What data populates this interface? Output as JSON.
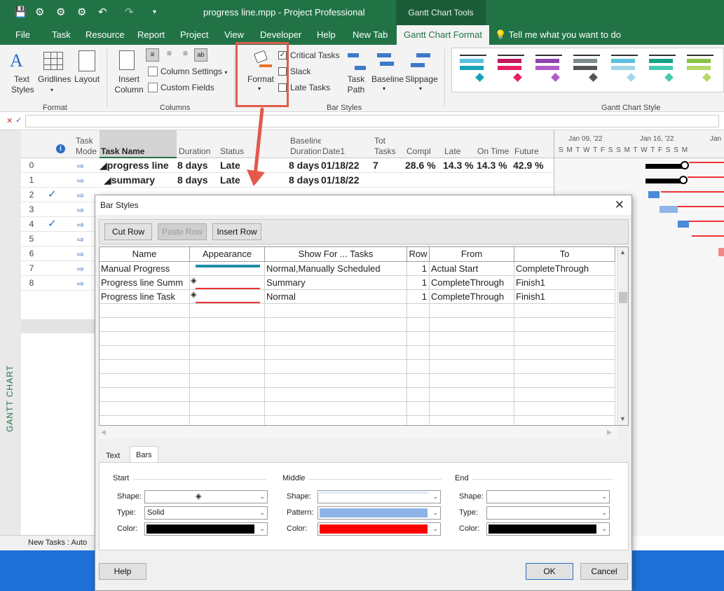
{
  "window": {
    "title": "progress line.mpp  -  Project Professional",
    "tools_tab": "Gantt Chart Tools"
  },
  "tabs": [
    "File",
    "Task",
    "Resource",
    "Report",
    "Project",
    "View",
    "Developer",
    "Help",
    "New Tab",
    "Gantt Chart Format"
  ],
  "tell_me": "Tell me what you want to do",
  "ribbon": {
    "text_styles": "Text Styles",
    "gridlines": "Gridlines",
    "layout": "Layout",
    "format_group": "Format",
    "insert_column": "Insert Column",
    "column_settings": "Column Settings",
    "custom_fields": "Custom Fields",
    "columns_group": "Columns",
    "format_btn": "Format",
    "critical_tasks": "Critical Tasks",
    "slack": "Slack",
    "late_tasks": "Late Tasks",
    "task_path": "Task Path",
    "baseline": "Baseline",
    "slippage": "Slippage",
    "bar_styles_group": "Bar Styles",
    "gantt_chart_style_group": "Gantt Chart Style"
  },
  "sheet": {
    "headers": {
      "task_mode": "Task Mode",
      "task_name": "Task Name",
      "duration": "Duration",
      "status": "Status",
      "baseline_duration": "Baseline Duration",
      "date1": "Date1",
      "tot_tasks": "Tot Tasks",
      "compl": "Compl",
      "late": "Late",
      "on_time": "On Time",
      "future": "Future"
    },
    "row_numbers": [
      "0",
      "1",
      "2",
      "3",
      "4",
      "5",
      "6",
      "7",
      "8"
    ],
    "row0": {
      "name": "progress line",
      "duration": "8 days",
      "status": "Late",
      "baseline": "8 days",
      "date1": "01/18/22",
      "tot": "7",
      "compl": "28.6 %",
      "late": "14.3 %",
      "ontime": "14.3 %",
      "future": "42.9 %"
    },
    "row1": {
      "name": "summary",
      "duration": "8 days",
      "status": "Late",
      "baseline": "8 days",
      "date1": "01/18/22"
    },
    "sidebar_label": "GANTT CHART",
    "status_bar": "New Tasks : Auto"
  },
  "gantt": {
    "week1": "Jan 09, '22",
    "week2": "Jan 16, '22",
    "week3": "Jan",
    "days": "S M T W T F S S M T W T F S S M"
  },
  "dialog": {
    "title": "Bar Styles",
    "cut_row": "Cut Row",
    "paste_row": "Paste Row",
    "insert_row": "Insert Row",
    "columns": [
      "Name",
      "Appearance",
      "Show For ... Tasks",
      "Row",
      "From",
      "To"
    ],
    "rows": [
      {
        "name": "Manual Progress",
        "show_for": "Normal,Manually Scheduled",
        "row": "1",
        "from": "Actual Start",
        "to": "CompleteThrough"
      },
      {
        "name": " Progress line Summ",
        "show_for": "Summary",
        "row": "1",
        "from": "CompleteThrough",
        "to": "Finish1"
      },
      {
        "name": "Progress line Task",
        "show_for": "Normal",
        "row": "1",
        "from": "CompleteThrough",
        "to": "Finish1"
      }
    ],
    "tab_text": "Text",
    "tab_bars": "Bars",
    "start_section": "Start",
    "middle_section": "Middle",
    "end_section": "End",
    "shape_label": "Shape:",
    "type_label": "Type:",
    "pattern_label": "Pattern:",
    "color_label": "Color:",
    "start_type": "Solid",
    "start_color": "#000000",
    "middle_pattern_color": "#8fb4e8",
    "middle_color": "#ff0000",
    "end_color": "#000000",
    "help": "Help",
    "ok": "OK",
    "cancel": "Cancel"
  }
}
